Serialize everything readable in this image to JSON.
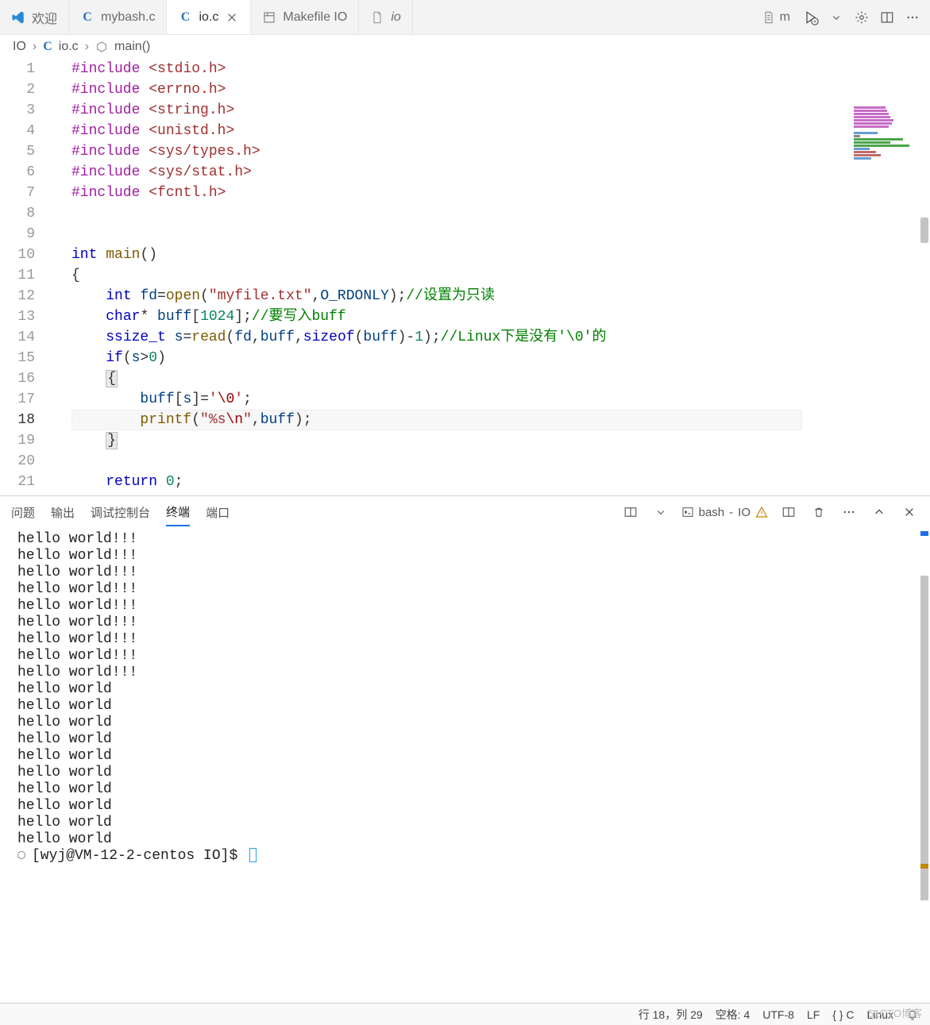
{
  "tabs": [
    {
      "label": "欢迎",
      "icon": "vscode"
    },
    {
      "label": "mybash.c",
      "icon": "c"
    },
    {
      "label": "io.c",
      "icon": "c",
      "active": true,
      "closable": true
    },
    {
      "label": "Makefile IO",
      "icon": "makefile"
    },
    {
      "label": "io",
      "icon": "file"
    }
  ],
  "toolbar_file": {
    "label": "m",
    "icon": "file-text"
  },
  "breadcrumb": [
    {
      "label": "IO"
    },
    {
      "label": "io.c",
      "icon": "c"
    },
    {
      "label": "main()",
      "icon": "outline"
    }
  ],
  "code": {
    "lines": [
      {
        "n": 1,
        "html": "<span class='pre'>#include</span> <span class='str'>&lt;stdio.h&gt;</span>"
      },
      {
        "n": 2,
        "html": "<span class='pre'>#include</span> <span class='str'>&lt;errno.h&gt;</span>"
      },
      {
        "n": 3,
        "html": "<span class='pre'>#include</span> <span class='str'>&lt;string.h&gt;</span>"
      },
      {
        "n": 4,
        "html": "<span class='pre'>#include</span> <span class='str'>&lt;unistd.h&gt;</span>"
      },
      {
        "n": 5,
        "html": "<span class='pre'>#include</span> <span class='str'>&lt;sys/types.h&gt;</span>"
      },
      {
        "n": 6,
        "html": "<span class='pre'>#include</span> <span class='str'>&lt;sys/stat.h&gt;</span>"
      },
      {
        "n": 7,
        "html": "<span class='pre'>#include</span> <span class='str'>&lt;fcntl.h&gt;</span>"
      },
      {
        "n": 8,
        "html": ""
      },
      {
        "n": 9,
        "html": ""
      },
      {
        "n": 10,
        "html": "<span class='kw'>int</span> <span class='fn'>main</span>()"
      },
      {
        "n": 11,
        "html": "{"
      },
      {
        "n": 12,
        "html": "    <span class='kw'>int</span> <span class='id'>fd</span>=<span class='fn'>open</span>(<span class='str'>\"myfile.txt\"</span>,<span class='id'>O_RDONLY</span>);<span class='cmt'>//设置为只读</span>"
      },
      {
        "n": 13,
        "html": "    <span class='kw'>char</span>* <span class='id'>buff</span>[<span class='num'>1024</span>];<span class='cmt'>//要写入buff</span>"
      },
      {
        "n": 14,
        "html": "    <span class='kw'>ssize_t</span> <span class='id'>s</span>=<span class='fn'>read</span>(<span class='id'>fd</span>,<span class='id'>buff</span>,<span class='kw'>sizeof</span>(<span class='id'>buff</span>)-<span class='num'>1</span>);<span class='cmt'>//Linux下是没有'\\0'的</span>"
      },
      {
        "n": 15,
        "html": "    <span class='kw'>if</span>(<span class='id'>s</span>&gt;<span class='num'>0</span>)"
      },
      {
        "n": 16,
        "html": "    <span class='brace-hi'>{</span>"
      },
      {
        "n": 17,
        "html": "        <span class='id'>buff</span>[<span class='id'>s</span>]=<span class='str'>'<span class='esc'>\\0</span>'</span>;"
      },
      {
        "n": 18,
        "html": "        <span class='fn'>printf</span>(<span class='str'>\"%s<span class='esc'>\\n</span>\"</span>,<span class='id'>buff</span>);",
        "current": true
      },
      {
        "n": 19,
        "html": "    <span class='brace-hi'>}</span>"
      },
      {
        "n": 20,
        "html": ""
      },
      {
        "n": 21,
        "html": "    <span class='kw'>return</span> <span class='num'>0</span>;"
      }
    ]
  },
  "panel": {
    "tabs": [
      "问题",
      "输出",
      "调试控制台",
      "终端",
      "端口"
    ],
    "activeTab": "终端",
    "shell": {
      "name": "bash",
      "context": "IO"
    },
    "output": [
      "hello world!!!",
      "hello world!!!",
      "hello world!!!",
      "hello world!!!",
      "hello world!!!",
      "hello world!!!",
      "hello world!!!",
      "hello world!!!",
      "hello world!!!",
      "hello world",
      "hello world",
      "hello world",
      "hello world",
      "hello world",
      "hello world",
      "hello world",
      "hello world",
      "hello world",
      "hello world"
    ],
    "prompt": "[wyj@VM-12-2-centos IO]$ "
  },
  "status": {
    "cursor": "行 18，列 29",
    "spaces": "空格: 4",
    "encoding": "UTF-8",
    "eol": "LF",
    "lang": "{ } C",
    "os": "Linux"
  },
  "watermark": "51CTO博客"
}
